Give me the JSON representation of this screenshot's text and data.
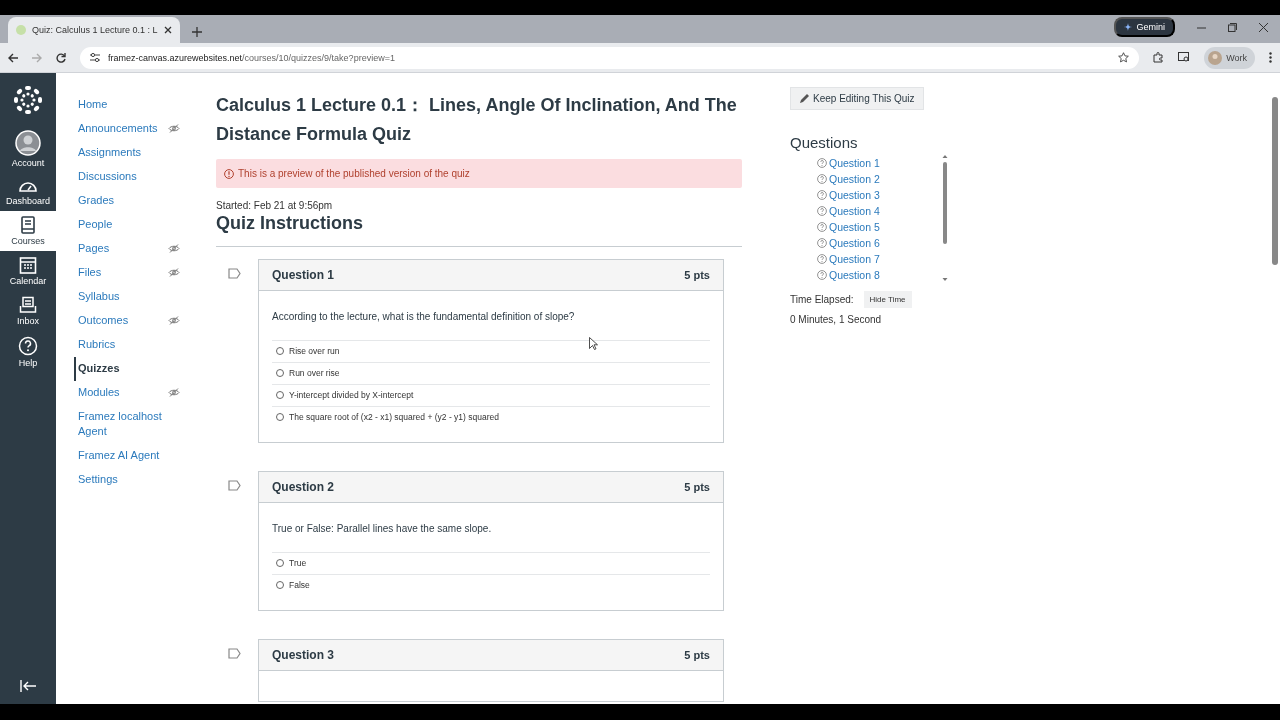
{
  "browser": {
    "tab_title": "Quiz: Calculus 1 Lecture 0.1 : L",
    "url_host": "framez-canvas.azurewebsites.net",
    "url_path": "/courses/10/quizzes/9/take?preview=1",
    "gemini_label": "Gemini",
    "profile_label": "Work"
  },
  "global_nav": [
    {
      "kind": "account",
      "label": "Account",
      "selected": false
    },
    {
      "kind": "dashboard",
      "label": "Dashboard",
      "selected": false
    },
    {
      "kind": "courses",
      "label": "Courses",
      "selected": true
    },
    {
      "kind": "calendar",
      "label": "Calendar",
      "selected": false
    },
    {
      "kind": "inbox",
      "label": "Inbox",
      "selected": false
    },
    {
      "kind": "help",
      "label": "Help",
      "selected": false
    }
  ],
  "course_nav": [
    {
      "label": "Home",
      "selected": false,
      "hidden": false
    },
    {
      "label": "Announcements",
      "selected": false,
      "hidden": true
    },
    {
      "label": "Assignments",
      "selected": false,
      "hidden": false
    },
    {
      "label": "Discussions",
      "selected": false,
      "hidden": false
    },
    {
      "label": "Grades",
      "selected": false,
      "hidden": false
    },
    {
      "label": "People",
      "selected": false,
      "hidden": false
    },
    {
      "label": "Pages",
      "selected": false,
      "hidden": true
    },
    {
      "label": "Files",
      "selected": false,
      "hidden": true
    },
    {
      "label": "Syllabus",
      "selected": false,
      "hidden": false
    },
    {
      "label": "Outcomes",
      "selected": false,
      "hidden": true
    },
    {
      "label": "Rubrics",
      "selected": false,
      "hidden": false
    },
    {
      "label": "Quizzes",
      "selected": true,
      "hidden": false
    },
    {
      "label": "Modules",
      "selected": false,
      "hidden": true
    },
    {
      "label": "Framez localhost Agent",
      "selected": false,
      "hidden": false
    },
    {
      "label": "Framez AI Agent",
      "selected": false,
      "hidden": false
    },
    {
      "label": "Settings",
      "selected": false,
      "hidden": false
    }
  ],
  "quiz": {
    "title": "Calculus 1 Lecture 0.1：  Lines, Angle Of Inclination, And The Distance Formula Quiz",
    "preview_notice": "This is a preview of the published version of the quiz",
    "started": "Started: Feb 21 at 9:56pm",
    "instructions_heading": "Quiz Instructions",
    "questions": [
      {
        "title": "Question 1",
        "points": "5 pts",
        "text": "According to the lecture, what is the fundamental definition of slope?",
        "answers": [
          {
            "label": "Rise over run",
            "selected": false
          },
          {
            "label": "Run over rise",
            "selected": false
          },
          {
            "label": "Y-intercept divided by X-intercept",
            "selected": false
          },
          {
            "label": "The square root of (x2 - x1) squared + (y2 - y1) squared",
            "selected": false
          }
        ]
      },
      {
        "title": "Question 2",
        "points": "5 pts",
        "text": "True or False: Parallel lines have the same slope.",
        "answers": [
          {
            "label": "True",
            "selected": false
          },
          {
            "label": "False",
            "selected": false
          }
        ]
      },
      {
        "title": "Question 3",
        "points": "5 pts"
      }
    ]
  },
  "sidebar": {
    "edit_button": "Keep Editing This Quiz",
    "questions_heading": "Questions",
    "question_links": [
      "Question 1",
      "Question 2",
      "Question 3",
      "Question 4",
      "Question 5",
      "Question 6",
      "Question 7",
      "Question 8"
    ],
    "time_label": "Time Elapsed:",
    "hide_time_button": "Hide Time",
    "time_value": "0 Minutes, 1 Second"
  }
}
